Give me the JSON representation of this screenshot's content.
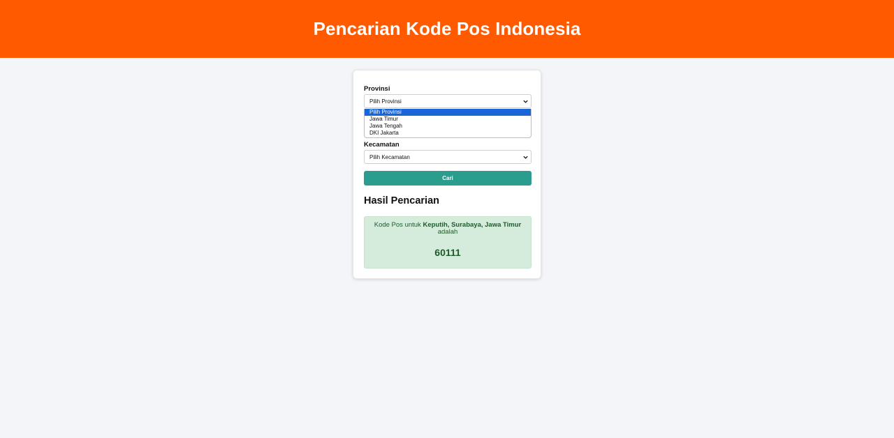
{
  "header": {
    "title": "Pencarian Kode Pos Indonesia"
  },
  "form": {
    "provinsi_label": "Provinsi",
    "provinsi_selected": "Pilih Provinsi",
    "provinsi_options": [
      "Pilih Provinsi",
      "Jawa Timur",
      "Jawa Tengah",
      "DKI Jakarta"
    ],
    "kecamatan_label": "Kecamatan",
    "kecamatan_selected": "Pilih Kecamatan",
    "search_button": "Cari"
  },
  "result": {
    "title": "Hasil Pencarian",
    "prefix": "Kode Pos untuk",
    "location": "Keputih, Surabaya, Jawa Timur",
    "suffix": "adalah",
    "code": "60111"
  },
  "colors": {
    "header_bg": "#ff5a00",
    "button_bg": "#2a9d8f",
    "result_bg": "#d5ecdc",
    "option_highlight": "#1a66d6",
    "page_bg": "#f3f5f8"
  },
  "icons": {
    "select_chevron": "chevron-down-icon"
  }
}
